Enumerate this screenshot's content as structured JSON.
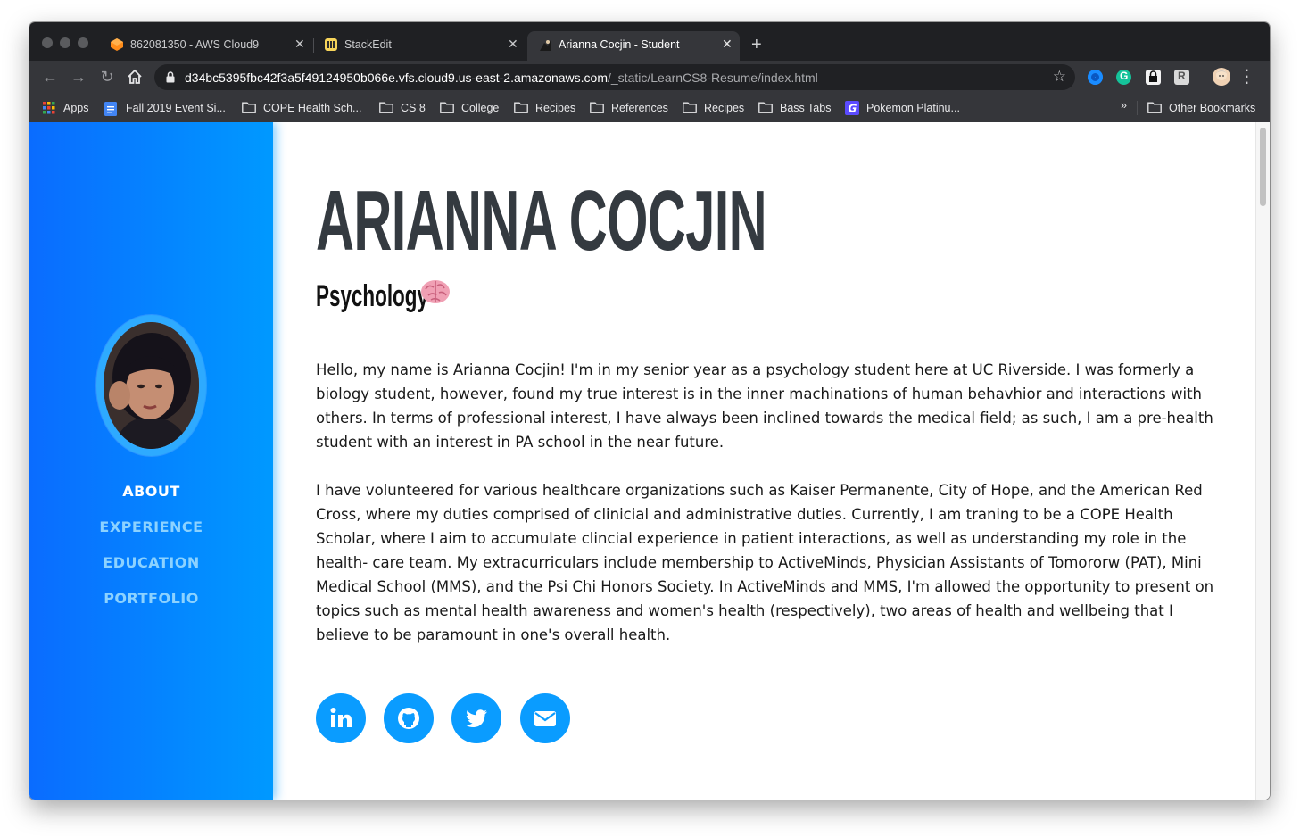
{
  "browser": {
    "tabs": [
      {
        "title": "862081350 - AWS Cloud9",
        "icon": "aws-cloud9-icon",
        "active": false
      },
      {
        "title": "StackEdit",
        "icon": "stackedit-icon",
        "active": false
      },
      {
        "title": "Arianna Cocjin - Student",
        "icon": "page-favicon",
        "active": true
      }
    ],
    "url_host": "d34bc5395fbc42f3a5f49124950b066e.vfs.cloud9.us-east-2.amazonaws.com",
    "url_path": "/_static/LearnCS8-Resume/index.html",
    "bookmarks": [
      {
        "label": "Apps",
        "icon": "apps-grid-icon"
      },
      {
        "label": "Fall 2019 Event Si...",
        "icon": "google-docs-icon"
      },
      {
        "label": "COPE Health Sch...",
        "icon": "folder-icon"
      },
      {
        "label": "CS 8",
        "icon": "folder-icon"
      },
      {
        "label": "College",
        "icon": "folder-icon"
      },
      {
        "label": "Recipes",
        "icon": "folder-icon"
      },
      {
        "label": "References",
        "icon": "folder-icon"
      },
      {
        "label": "Recipes",
        "icon": "folder-icon"
      },
      {
        "label": "Bass Tabs",
        "icon": "folder-icon"
      },
      {
        "label": "Pokemon Platinu...",
        "icon": "pokemon-site-icon"
      }
    ],
    "bookmarks_overflow": "»",
    "other_bookmarks": "Other Bookmarks"
  },
  "sidebar": {
    "nav": [
      {
        "label": "ABOUT",
        "active": true
      },
      {
        "label": "EXPERIENCE",
        "active": false
      },
      {
        "label": "EDUCATION",
        "active": false
      },
      {
        "label": "PORTFOLIO",
        "active": false
      }
    ]
  },
  "main": {
    "name": "ARIANNA COCJIN",
    "subtitle": "Psychology",
    "subtitle_emoji": "brain-icon",
    "paragraphs": [
      "Hello, my name is Arianna Cocjin! I'm in my senior year as a psychology student here at UC Riverside. I was formerly a biology student, however, found my true interest is in the inner machinations of human behavhior and interactions with others. In terms of professional interest, I have always been inclined towards the medical field; as such, I am a pre-health student with an interest in PA school in the near future.",
      "I have volunteered for various healthcare organizations such as Kaiser Permanente, City of Hope, and the American Red Cross, where my duties comprised of clinicial and administrative duties. Currently, I am traning to be a COPE Health Scholar, where I aim to accumulate clincial experience in patient interactions, as well as understanding my role in the health- care team. My extracurriculars include membership to ActiveMinds, Physician Assistants of Tomororw (PAT), Mini Medical School (MMS), and the Psi Chi Honors Society. In ActiveMinds and MMS, I'm allowed the opportunity to present on topics such as mental health awareness and women's health (respectively), two areas of health and wellbeing that I believe to be paramount in one's overall health."
    ],
    "social": [
      "linkedin-icon",
      "github-icon",
      "twitter-icon",
      "envelope-icon"
    ]
  },
  "colors": {
    "sidebar_start": "#0a6cff",
    "sidebar_end": "#0099ff",
    "social_bg": "#0a9cff",
    "name_color": "#343a40"
  }
}
